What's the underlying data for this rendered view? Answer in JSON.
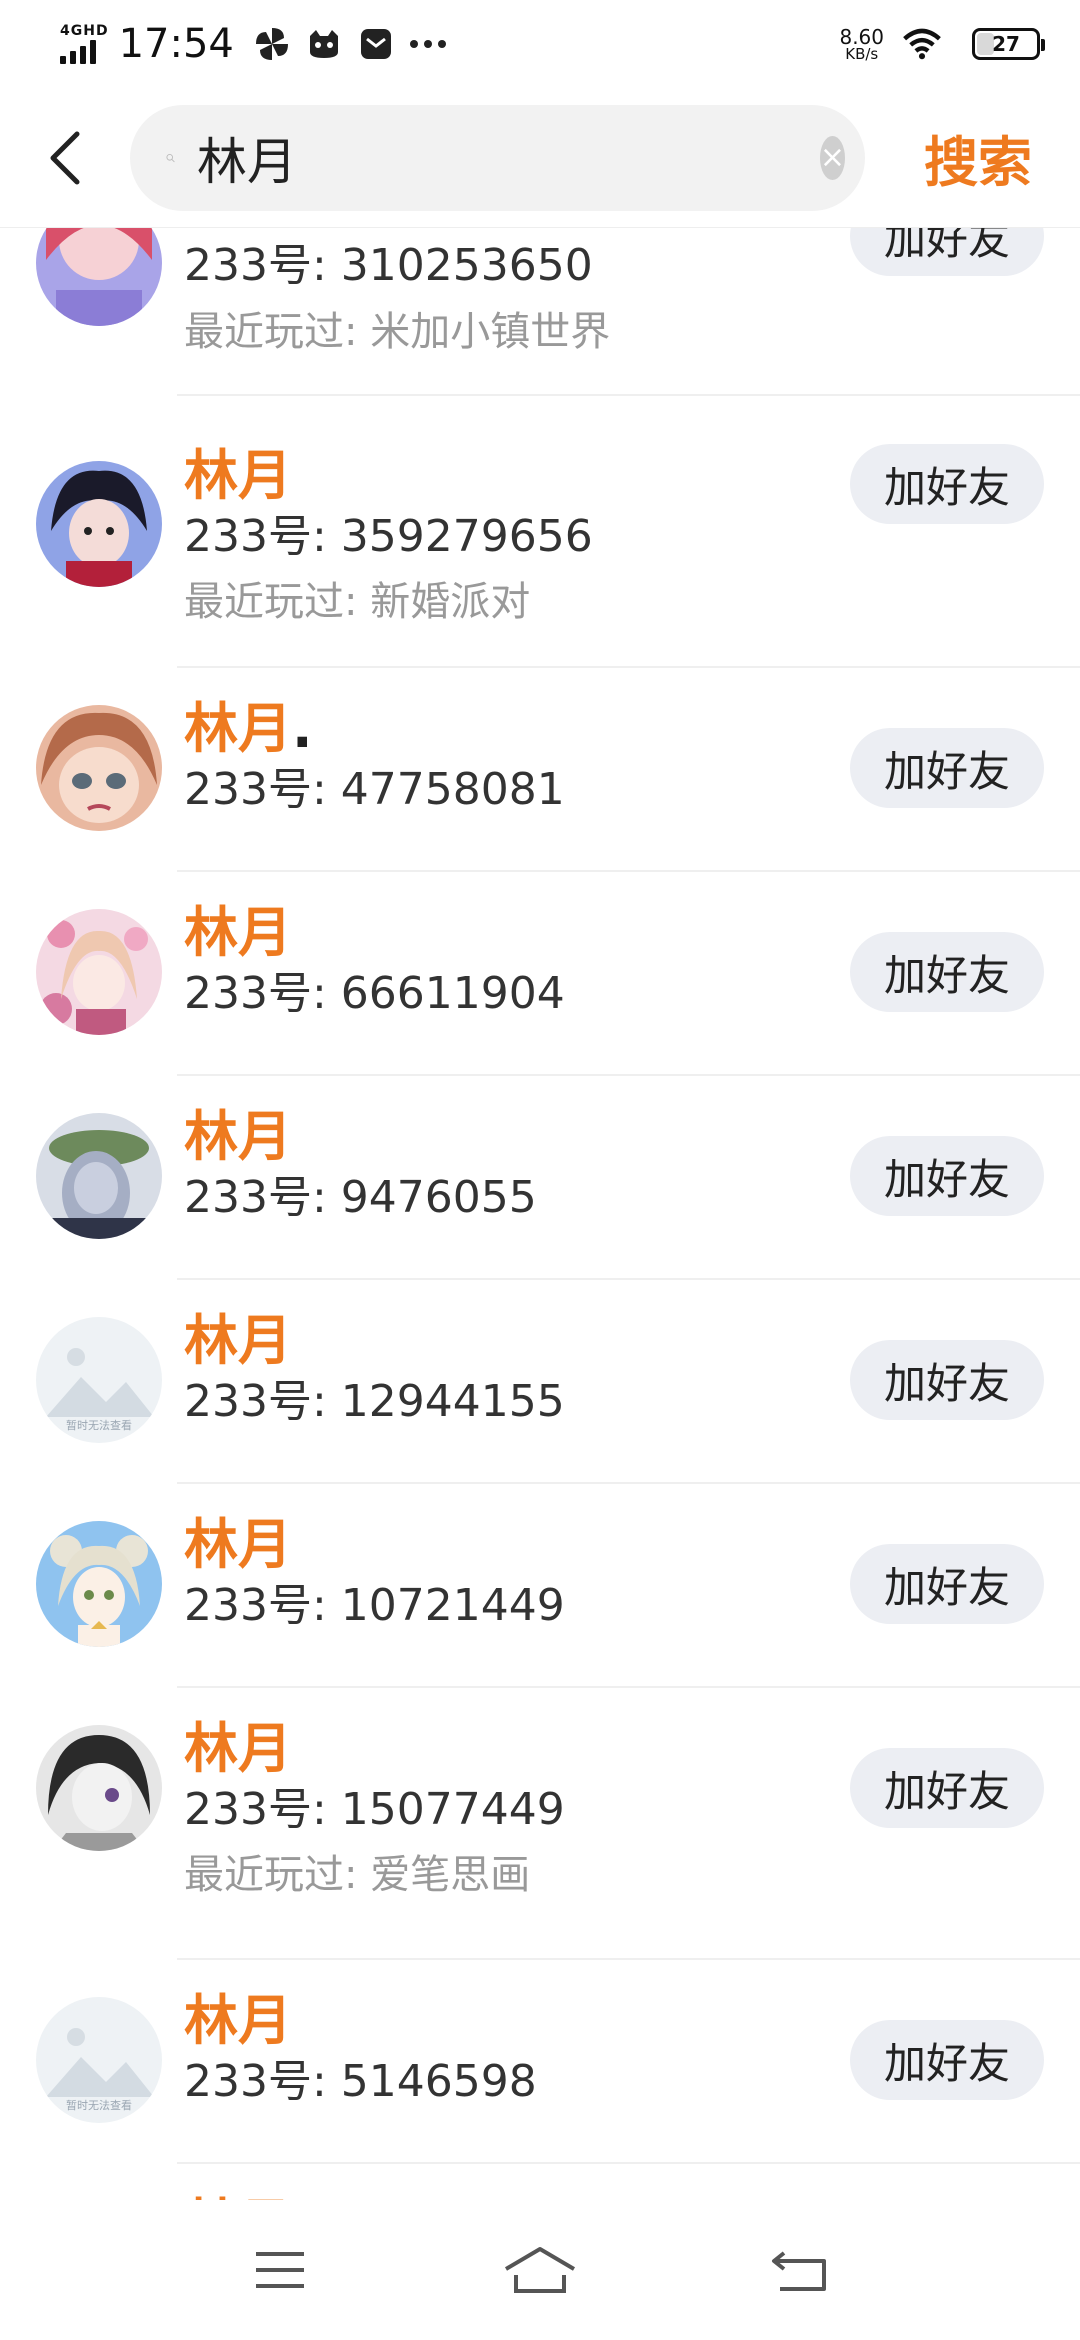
{
  "status_bar": {
    "network": "4GHD",
    "time": "17:54",
    "speed_value": "8.60",
    "speed_unit": "KB/s",
    "battery": "27",
    "battery_level": 0.27
  },
  "search": {
    "query": "林月",
    "submit_label": "搜索"
  },
  "results": [
    {
      "name": "",
      "uid": "233号: 310253650",
      "recent": "最近玩过: 米加小镇世界",
      "add_label": "加好友",
      "avatar": "anime-girl-pink-hair"
    },
    {
      "name": "林月",
      "uid": "233号: 359279656",
      "recent": "最近玩过: 新婚派对",
      "add_label": "加好友",
      "avatar": "anime-boy-dark-hair"
    },
    {
      "name": "林月",
      "name_suffix": ".",
      "uid": "233号: 47758081",
      "recent": "",
      "add_label": "加好友",
      "avatar": "anime-girl-crying"
    },
    {
      "name": "林月",
      "uid": "233号: 66611904",
      "recent": "",
      "add_label": "加好友",
      "avatar": "anime-girl-pink-flowers"
    },
    {
      "name": "林月",
      "uid": "233号: 9476055",
      "recent": "",
      "add_label": "加好友",
      "avatar": "blurred-photo"
    },
    {
      "name": "林月",
      "uid": "233号: 12944155",
      "recent": "",
      "add_label": "加好友",
      "avatar": "placeholder-image",
      "avatar_text": "暂时无法查看"
    },
    {
      "name": "林月",
      "uid": "233号: 10721449",
      "recent": "",
      "add_label": "加好友",
      "avatar": "anime-girl-blue-background"
    },
    {
      "name": "林月",
      "uid": "233号: 15077449",
      "recent": "最近玩过: 爱笔思画",
      "add_label": "加好友",
      "avatar": "anime-boy-grayscale"
    },
    {
      "name": "林月",
      "uid": "233号: 5146598",
      "recent": "",
      "add_label": "加好友",
      "avatar": "placeholder-image",
      "avatar_text": "暂时无法查看"
    },
    {
      "name": "林月",
      "uid": "",
      "recent": "",
      "add_label": "",
      "avatar": "placeholder-image"
    }
  ],
  "colors": {
    "accent": "#ee7a1f",
    "button_bg": "#eceef3",
    "secondary_text": "#999999"
  }
}
